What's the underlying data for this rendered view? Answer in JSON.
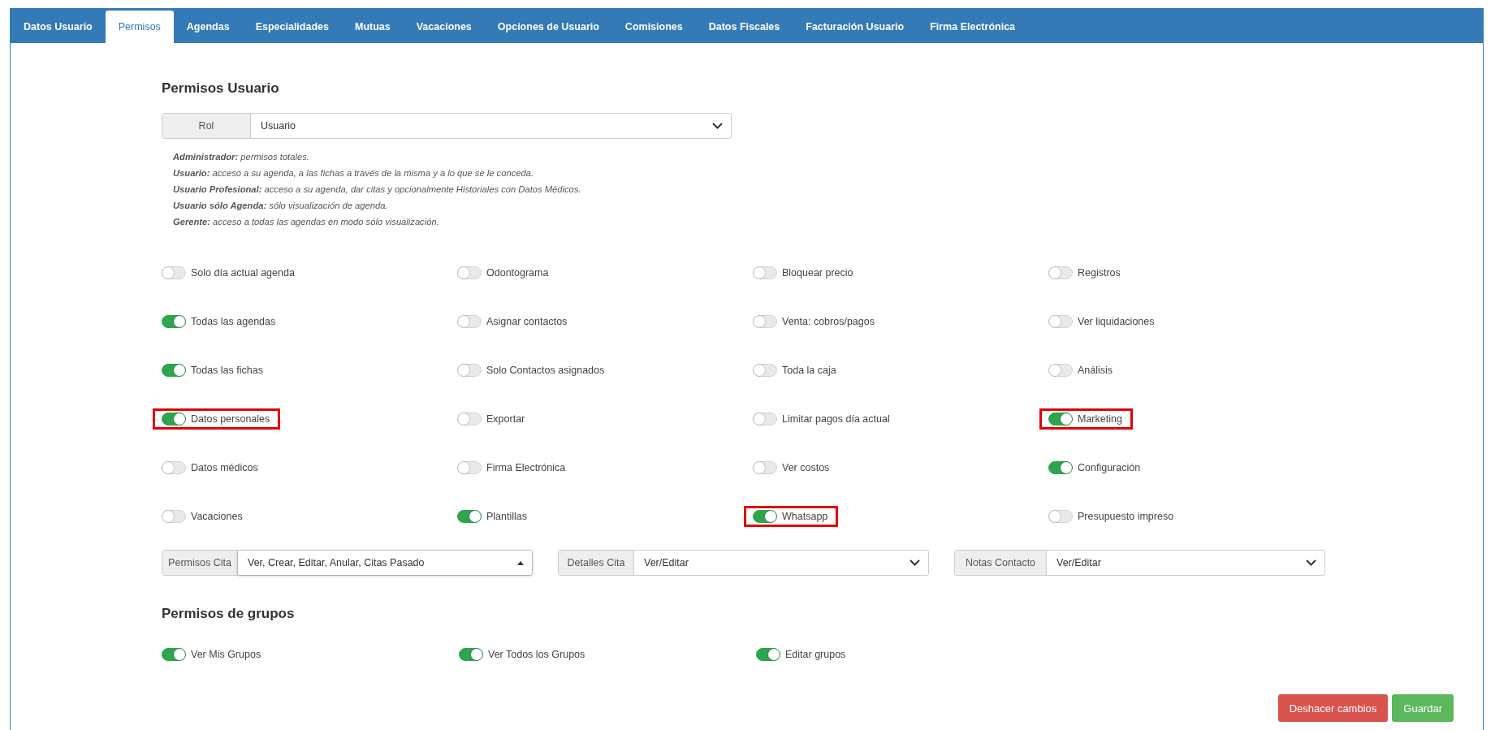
{
  "tabs": [
    {
      "label": "Datos Usuario",
      "selected": false
    },
    {
      "label": "Permisos",
      "selected": true
    },
    {
      "label": "Agendas",
      "selected": false
    },
    {
      "label": "Especialidades",
      "selected": false
    },
    {
      "label": "Mutuas",
      "selected": false
    },
    {
      "label": "Vacaciones",
      "selected": false
    },
    {
      "label": "Opciones de Usuario",
      "selected": false
    },
    {
      "label": "Comisiones",
      "selected": false
    },
    {
      "label": "Datos Fiscales",
      "selected": false
    },
    {
      "label": "Facturación Usuario",
      "selected": false
    },
    {
      "label": "Firma Electrónica",
      "selected": false
    }
  ],
  "user_permissions": {
    "heading": "Permisos Usuario",
    "role": {
      "label": "Rol",
      "value": "Usuario"
    },
    "role_descriptions": [
      "**Administrador:** permisos totales.",
      "**Usuario:** acceso a su agenda, a las fichas a través de la misma y a lo que se le conceda.",
      "**Usuario Profesional:** acceso a su agenda, dar citas y opcionalmente Historiales con Datos Médicos.",
      "**Usuario sólo Agenda:** sólo visualización de agenda.",
      "**Gerente:** acceso a todas las agendas en modo sólo visualización."
    ],
    "toggles": [
      {
        "label": "Solo día actual agenda",
        "on": false,
        "highlighted": false
      },
      {
        "label": "Odontograma",
        "on": false,
        "highlighted": false
      },
      {
        "label": "Bloquear precio",
        "on": false,
        "highlighted": false
      },
      {
        "label": "Registros",
        "on": false,
        "highlighted": false
      },
      {
        "label": "Todas las agendas",
        "on": true,
        "highlighted": false
      },
      {
        "label": "Asignar contactos",
        "on": false,
        "highlighted": false
      },
      {
        "label": "Venta: cobros/pagos",
        "on": false,
        "highlighted": false
      },
      {
        "label": "Ver liquidaciones",
        "on": false,
        "highlighted": false
      },
      {
        "label": "Todas las fichas",
        "on": true,
        "highlighted": false
      },
      {
        "label": "Solo Contactos asignados",
        "on": false,
        "highlighted": false
      },
      {
        "label": "Toda la caja",
        "on": false,
        "highlighted": false
      },
      {
        "label": "Análisis",
        "on": false,
        "highlighted": false
      },
      {
        "label": "Datos personales",
        "on": true,
        "highlighted": true
      },
      {
        "label": "Exportar",
        "on": false,
        "highlighted": false
      },
      {
        "label": "Limitar pagos día actual",
        "on": false,
        "highlighted": false
      },
      {
        "label": "Marketing",
        "on": true,
        "highlighted": true
      },
      {
        "label": "Datos médicos",
        "on": false,
        "highlighted": false
      },
      {
        "label": "Firma Electrónica",
        "on": false,
        "highlighted": false
      },
      {
        "label": "Ver costos",
        "on": false,
        "highlighted": false
      },
      {
        "label": "Configuración",
        "on": true,
        "highlighted": false
      },
      {
        "label": "Vacaciones",
        "on": false,
        "highlighted": false
      },
      {
        "label": "Plantillas",
        "on": true,
        "highlighted": false
      },
      {
        "label": "Whatsapp",
        "on": true,
        "highlighted": true
      },
      {
        "label": "Presupuesto impreso",
        "on": false,
        "highlighted": false
      }
    ],
    "selects": [
      {
        "label": "Permisos Cita",
        "value": "Ver, Crear, Editar, Anular, Citas Pasado",
        "expanded": true
      },
      {
        "label": "Detalles Cita",
        "value": "Ver/Editar",
        "expanded": false
      },
      {
        "label": "Notas Contacto",
        "value": "Ver/Editar",
        "expanded": false
      }
    ]
  },
  "group_permissions": {
    "heading": "Permisos de grupos",
    "toggles": [
      {
        "label": "Ver Mis Grupos",
        "on": true
      },
      {
        "label": "Ver Todos los Grupos",
        "on": true
      },
      {
        "label": "Editar grupos",
        "on": true
      }
    ]
  },
  "buttons": [
    {
      "label": "Deshacer cambios",
      "kind": "danger"
    },
    {
      "label": "Guardar",
      "kind": "success"
    }
  ]
}
